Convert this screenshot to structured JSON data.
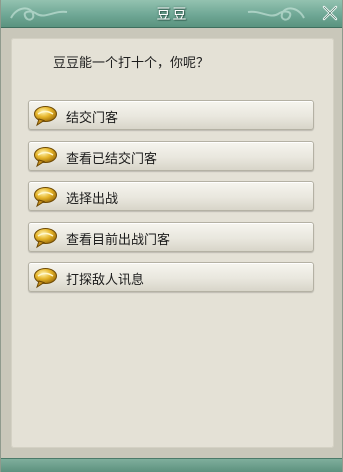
{
  "dialog": {
    "title": "豆豆",
    "prompt": "豆豆能一个打十个，你呢？",
    "accent": "#6fa795",
    "options": [
      {
        "label": "结交门客",
        "icon": "speech-bubble-icon"
      },
      {
        "label": "查看已结交门客",
        "icon": "speech-bubble-icon"
      },
      {
        "label": "选择出战",
        "icon": "speech-bubble-icon"
      },
      {
        "label": "查看目前出战门客",
        "icon": "speech-bubble-icon"
      },
      {
        "label": "打探敌人讯息",
        "icon": "speech-bubble-icon"
      }
    ],
    "close_icon": "close-icon"
  }
}
